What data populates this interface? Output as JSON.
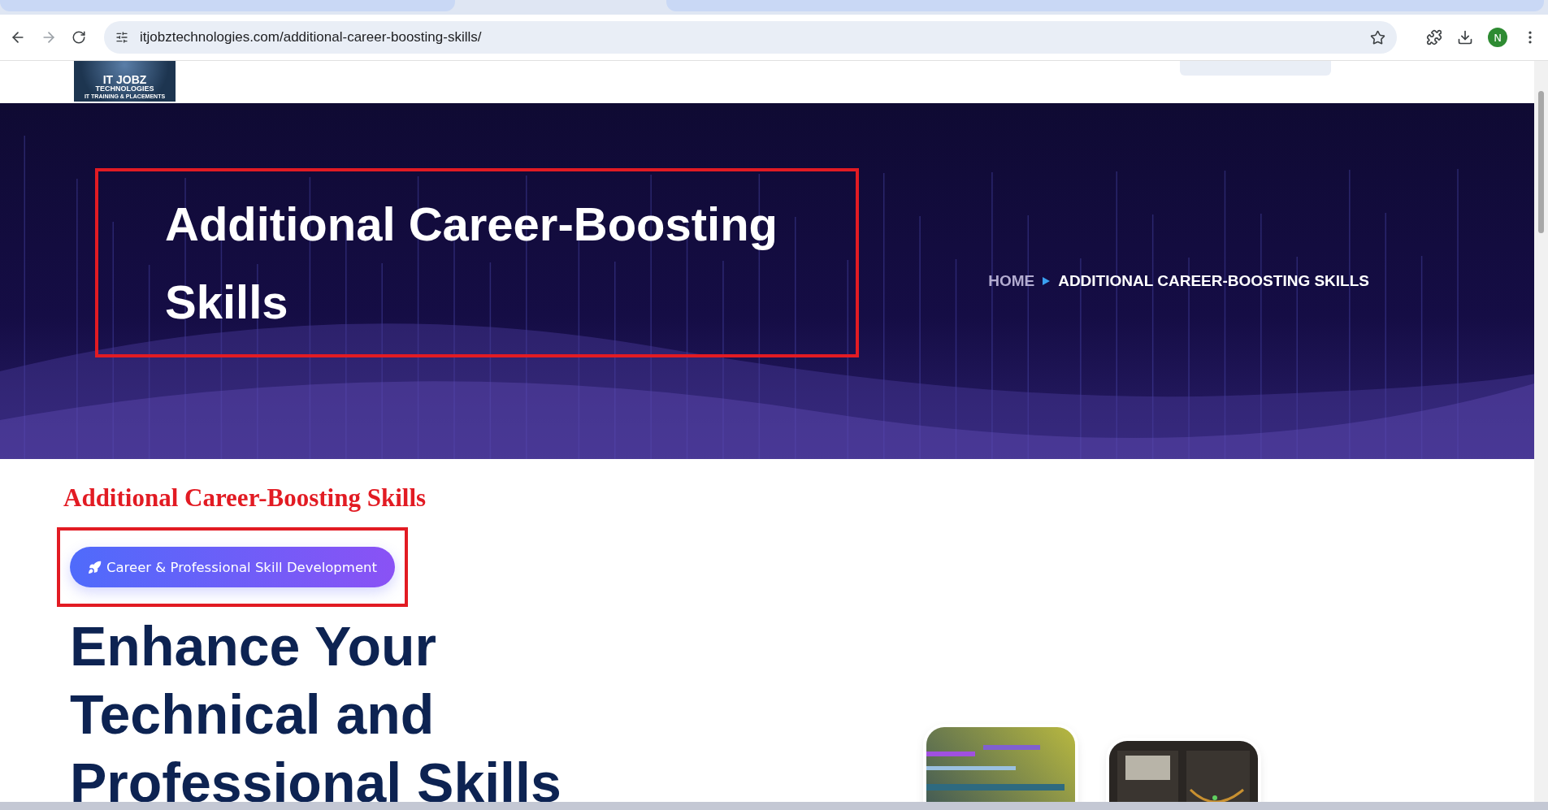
{
  "browser": {
    "url": "itjobztechnologies.com/additional-career-boosting-skills/",
    "profile_initial": "N"
  },
  "logo": {
    "title": "IT JOBZ",
    "subtitle": "TECHNOLOGIES",
    "tagline": "IT TRAINING & PLACEMENTS"
  },
  "hero": {
    "title": "Additional Career-Boosting Skills",
    "breadcrumb": [
      {
        "label": "HOME",
        "current": false
      },
      {
        "label": "ADDITIONAL CAREER-BOOSTING SKILLS",
        "current": true
      }
    ]
  },
  "section": {
    "heading": "Additional Career-Boosting Skills",
    "badge": "Career & Professional Skill Development",
    "headline": [
      "Enhance Your",
      "Technical and",
      "Professional Skills"
    ]
  }
}
